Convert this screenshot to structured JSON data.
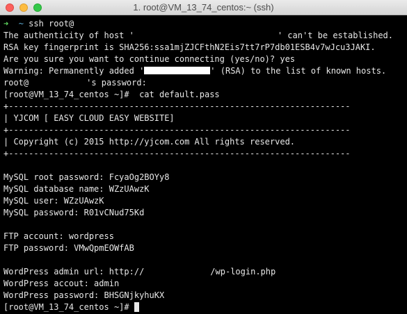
{
  "window": {
    "title": "1. root@VM_13_74_centos:~ (ssh)"
  },
  "terminal": {
    "prompt_arrow": "➜",
    "prompt_tilde": "~",
    "cmd_ssh": "ssh root@",
    "auth_a": "The authenticity of host '",
    "auth_b": "' can't be established.",
    "rsa_fingerprint": "RSA key fingerprint is SHA256:ssa1mjZJCFthN2Eis7tt7rP7db01ESB4v7wJcu3JAKI.",
    "continue_question": "Are you sure you want to continue connecting (yes/no)? yes",
    "warning_a": "Warning: Permanently added '",
    "warning_b": "' (RSA) to the list of known hosts.",
    "password_a": "root@",
    "password_b": "'s password:",
    "cat_cmd": "[root@VM_13_74_centos ~]#  cat default.pass",
    "divider": "+--------------------------------------------------------------------",
    "banner": "| YJCOM [ EASY CLOUD EASY WEBSITE]",
    "copyright": "| Copyright (c) 2015 http://yjcom.com All rights reserved.",
    "mysql_root_password": "MySQL root password: FcyaOg2BOYy8",
    "mysql_db_name": "MySQL database name: WZzUAwzK",
    "mysql_user": "MySQL user: WZzUAwzK",
    "mysql_password": "MySQL password: R01vCNud75Kd",
    "ftp_account": "FTP account: wordpress",
    "ftp_password": "FTP password: VMwQpmEOWfAB",
    "wp_url_a": "WordPress admin url: http://",
    "wp_url_b": "/wp-login.php",
    "wp_account": "WordPress accout: admin",
    "wp_password": "WordPress password: BHSGNjkyhuKX",
    "final_prompt": "[root@VM_13_74_centos ~]# "
  }
}
